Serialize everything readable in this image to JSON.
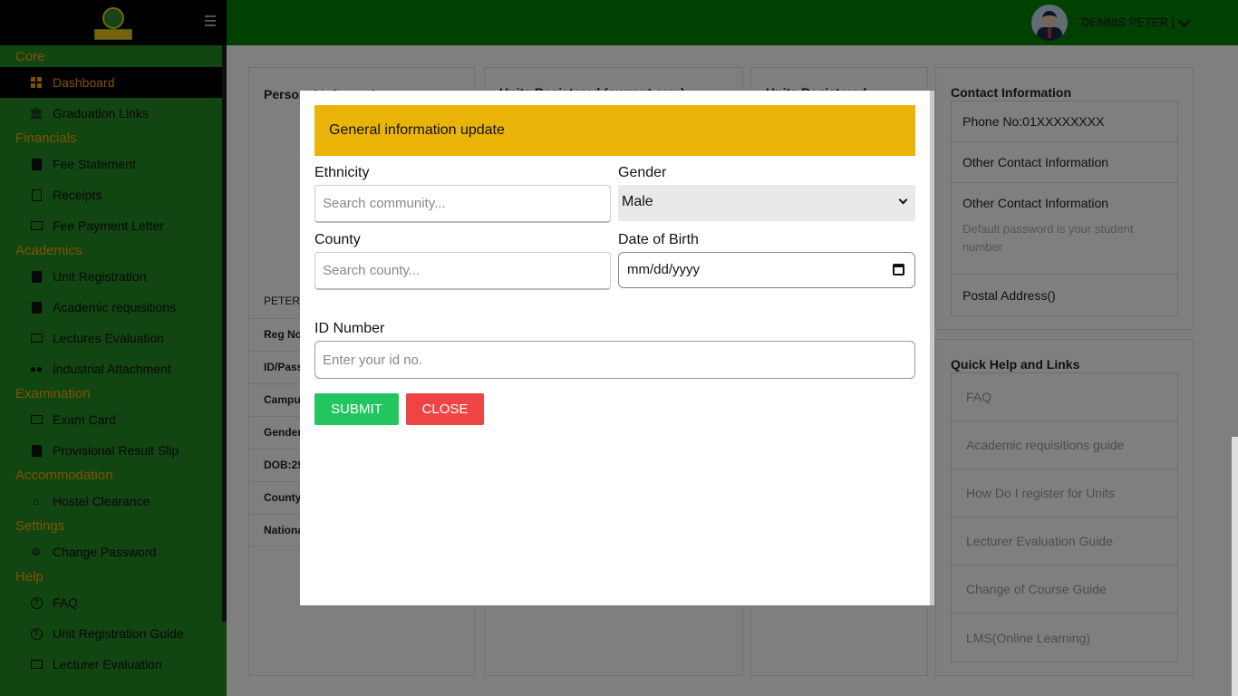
{
  "user": {
    "name": "DENNIS PETER |"
  },
  "sidebar": {
    "sections": [
      {
        "title": "Core",
        "items": [
          {
            "label": "Dashboard",
            "icon": "dashboard-icon"
          },
          {
            "label": "Graduation Links",
            "icon": "university-icon"
          }
        ]
      },
      {
        "title": "Financials",
        "items": [
          {
            "label": "Fee Statement",
            "icon": "document-icon"
          },
          {
            "label": "Receipts",
            "icon": "receipt-icon"
          },
          {
            "label": "Fee Payment Letter",
            "icon": "credit-card-icon"
          }
        ]
      },
      {
        "title": "Academics",
        "items": [
          {
            "label": "Unit Registration",
            "icon": "clipboard-icon"
          },
          {
            "label": "Academic requisitions",
            "icon": "clipboard-icon"
          },
          {
            "label": "Lectures Evaluation",
            "icon": "chalkboard-icon"
          },
          {
            "label": "Industrial Attachment",
            "icon": "users-icon"
          }
        ]
      },
      {
        "title": "Examination",
        "items": [
          {
            "label": "Exam Card",
            "icon": "id-card-icon"
          },
          {
            "label": "Provisional Result Slip",
            "icon": "document-icon"
          }
        ]
      },
      {
        "title": "Accommodation",
        "items": [
          {
            "label": "Hostel Clearance",
            "icon": "home-icon"
          }
        ]
      },
      {
        "title": "Settings",
        "items": [
          {
            "label": "Change Password",
            "icon": "gear-icon"
          }
        ]
      },
      {
        "title": "Help",
        "items": [
          {
            "label": "FAQ",
            "icon": "question-circle-icon"
          },
          {
            "label": "Unit Registration Guide",
            "icon": "question-circle-icon"
          },
          {
            "label": "Lecturer Evaluation",
            "icon": "chalkboard-icon"
          }
        ]
      }
    ]
  },
  "dashboard": {
    "personal_title": "Personal Information",
    "personal_rows": [
      "PETER",
      "Reg No",
      "ID/Pass",
      "Campus",
      "Gender",
      "DOB:29",
      "County",
      "National"
    ],
    "units_current_title": "Units Registered (current sem)",
    "units_title": "Units Registered",
    "contact_title": "Contact Information",
    "contact_phone": "Phone No:01XXXXXXXX",
    "contact_other_1": "Other Contact Information",
    "contact_other_2": "Other Contact Information",
    "contact_note": "Default password is your student number",
    "contact_postal": "Postal Address()",
    "quick_title": "Quick Help and Links",
    "quick_links": [
      "FAQ",
      "Academic requisitions guide",
      "How Do I register for Units",
      "Lecturer Evaluation Guide",
      "Change of Course Guide",
      "LMS(Online Learning)"
    ]
  },
  "modal": {
    "title": "General information update",
    "ethnicity_label": "Ethnicity",
    "ethnicity_placeholder": "Search community...",
    "gender_label": "Gender",
    "gender_value": "Male",
    "county_label": "County",
    "county_placeholder": "Search county...",
    "dob_label": "Date of Birth",
    "dob_placeholder": "mm/dd/yyyy",
    "id_label": "ID Number",
    "id_placeholder": "Enter your id no.",
    "submit_label": "SUBMIT",
    "close_label": "CLOSE"
  }
}
